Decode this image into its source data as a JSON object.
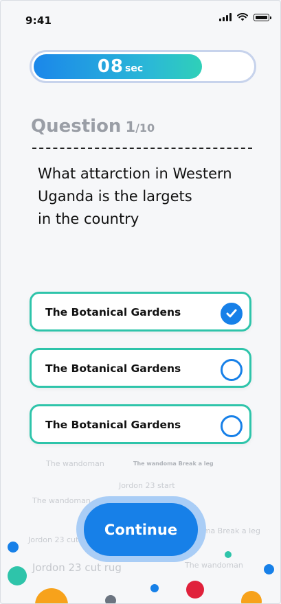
{
  "status_bar": {
    "time": "9:41"
  },
  "timer": {
    "value": "08",
    "unit": "sec",
    "progress": 0.77
  },
  "question": {
    "label": "Question",
    "number": "1",
    "total": "/10",
    "lines": [
      "What attarction in Western",
      "Uganda is the largets",
      "in the country"
    ]
  },
  "options": [
    {
      "label": "The Botanical Gardens",
      "selected": true
    },
    {
      "label": "The Botanical Gardens",
      "selected": false
    },
    {
      "label": "The Botanical Gardens",
      "selected": false
    }
  ],
  "background_labels": [
    "The wandoman",
    "The wandoma  Break a leg",
    "Jordon 23  start",
    "The wandoman",
    "Jordon 23  cut",
    "oma  Break a leg",
    "Jordon 23  cut rug",
    "The wandoman"
  ],
  "continue_label": "Continue",
  "colors": {
    "primary": "#1780e8",
    "accent_teal": "#2ec4aa",
    "timer_track": "#c7d3ec",
    "dot_red": "#e0213b",
    "dot_orange": "#f7a21b"
  }
}
